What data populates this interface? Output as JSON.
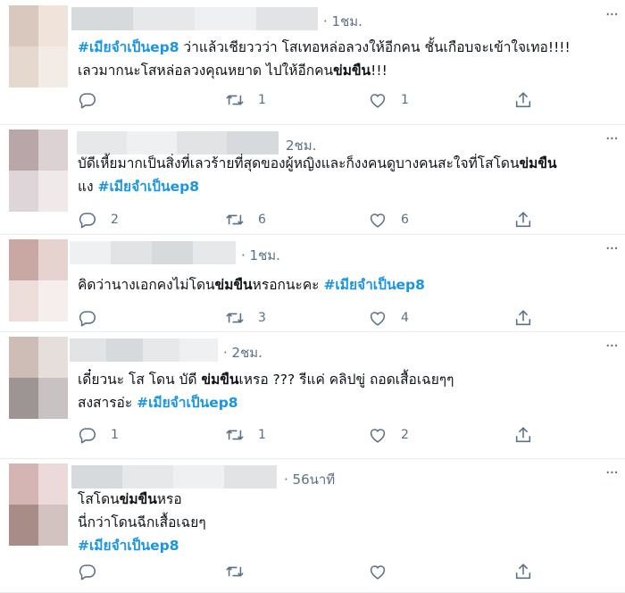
{
  "more_glyph": "···",
  "tweets": [
    {
      "time": "· 1ชม.",
      "lines": [
        [
          {
            "t": "#เมียจำเป็นep8",
            "k": "hashtag"
          },
          {
            "t": " ว่าแล้วเชียววว่า โสเทอหล่อลวงให้อีกคน ชั้นเกือบจะเข้าใจเทอ!!!!",
            "k": "plain"
          }
        ],
        [
          {
            "t": "เลวมากนะโสหล่อลวงคุณหยาด ไปให้อีกคน",
            "k": "plain"
          },
          {
            "t": "ข่มขืน",
            "k": "strong"
          },
          {
            "t": "!!!",
            "k": "plain"
          }
        ]
      ],
      "reply": "",
      "retweet": "1",
      "like": "1",
      "avatar_colors": [
        "#d9c8bd",
        "#efe3da",
        "#e4d8cf",
        "#f2ebe6"
      ]
    },
    {
      "time": "2ชม.",
      "lines": [
        [
          {
            "t": "บัดีเหี้ยมากเป็นสิ่งที่เลวร้ายที่สุดของผู้หญิงและก็งงคนดูบางคนสะใจที่โสโดน",
            "k": "plain"
          },
          {
            "t": "ข่มขืน",
            "k": "strong"
          }
        ],
        [
          {
            "t": "แง ",
            "k": "plain"
          },
          {
            "t": "#เมียจำเป็นep8",
            "k": "hashtag"
          }
        ]
      ],
      "reply": "2",
      "retweet": "6",
      "like": "6",
      "avatar_colors": [
        "#b9a6a8",
        "#ddd2d3",
        "#ddd5d7",
        "#efe9ea"
      ]
    },
    {
      "time": "· 1ชม.",
      "lines": [
        [
          {
            "t": "คิดว่านางเอกคงไม่โดน",
            "k": "plain"
          },
          {
            "t": "ข่มขืน",
            "k": "strong"
          },
          {
            "t": "หรอกนะคะ ",
            "k": "plain"
          },
          {
            "t": "#เมียจำเป็นep8",
            "k": "hashtag"
          }
        ]
      ],
      "reply": "",
      "retweet": "3",
      "like": "4",
      "avatar_colors": [
        "#c9a7a3",
        "#e6d3d0",
        "#eddddb",
        "#f5eeed"
      ]
    },
    {
      "time": "· 2ชม.",
      "lines": [
        [
          {
            "t": "เดี๋ยวนะ โส โดน บัดี ",
            "k": "plain"
          },
          {
            "t": "ข่มขืน",
            "k": "strong"
          },
          {
            "t": "เหรอ ??? รีแค่ คลิปขู่ ถอดเสื้อเฉยๆๆ",
            "k": "plain"
          }
        ],
        [
          {
            "t": "สงสารอ่ะ ",
            "k": "plain"
          },
          {
            "t": "#เมียจำเป็นep8",
            "k": "hashtag"
          }
        ]
      ],
      "reply": "1",
      "retweet": "1",
      "like": "2",
      "avatar_colors": [
        "#cdbdb6",
        "#e6dedb",
        "#9c9594",
        "#c8c3c2"
      ]
    },
    {
      "time": "· 56นาที",
      "lines": [
        [
          {
            "t": "โสโดน",
            "k": "plain"
          },
          {
            "t": "ข่มขืน",
            "k": "strong"
          },
          {
            "t": "หรอ",
            "k": "plain"
          }
        ],
        [
          {
            "t": "นี่กว่าโดนฉีกเสื้อเฉยๆ",
            "k": "plain"
          }
        ],
        [
          {
            "t": "#เมียจำเป็นep8",
            "k": "hashtag"
          }
        ]
      ],
      "reply": "",
      "retweet": "",
      "like": "",
      "avatar_colors": [
        "#d5b4b4",
        "#ecd9d9",
        "#a78c87",
        "#d2c3c1"
      ]
    }
  ]
}
